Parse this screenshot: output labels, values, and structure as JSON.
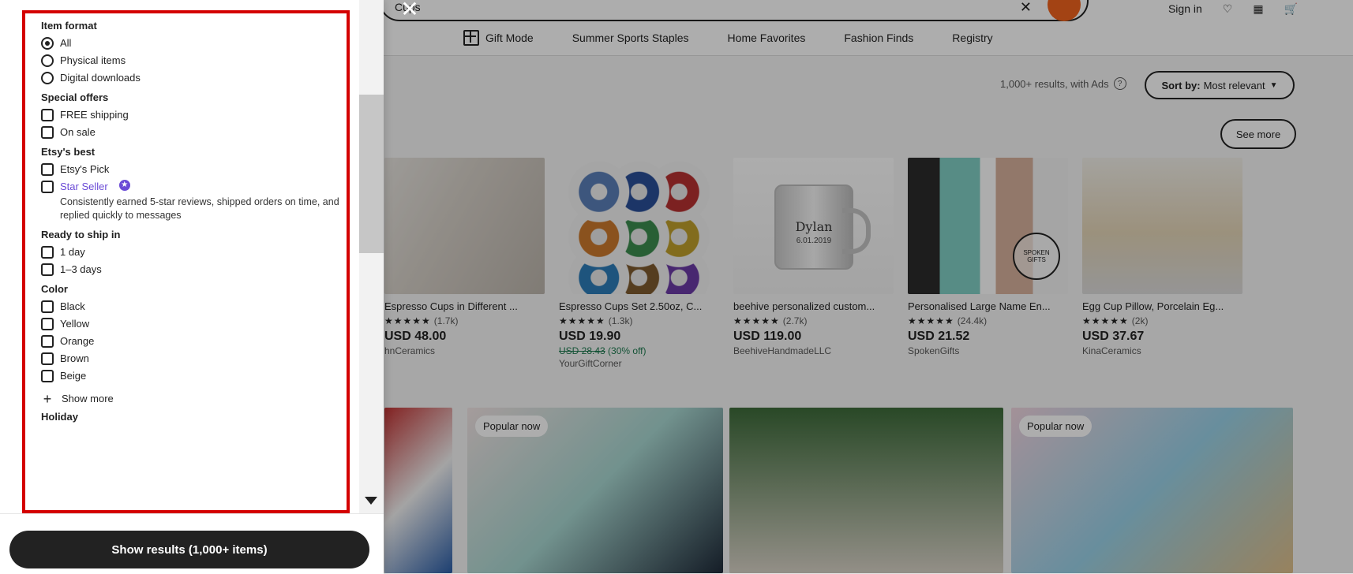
{
  "topbar": {
    "search_query": "Cups",
    "sign_in": "Sign in"
  },
  "nav": {
    "items": [
      {
        "label": "Gift Mode",
        "icon": "gift-icon"
      },
      {
        "label": "Summer Sports Staples"
      },
      {
        "label": "Home Favorites"
      },
      {
        "label": "Fashion Finds"
      },
      {
        "label": "Registry"
      }
    ]
  },
  "results": {
    "meta": "1,000+ results, with Ads",
    "sort_prefix": "Sort by:",
    "sort_value": "Most relevant",
    "see_more": "See more"
  },
  "cards": [
    {
      "title": "Espresso Cups in Different ...",
      "reviews": "(1.7k)",
      "price": "USD 48.00",
      "shop": "hnCeramics"
    },
    {
      "title": "Espresso Cups Set 2.50oz, C...",
      "reviews": "(1.3k)",
      "price": "USD 19.90",
      "old_price": "USD 28.43",
      "discount": "(30% off)",
      "shop": "YourGiftCorner"
    },
    {
      "title": "beehive personalized custom...",
      "reviews": "(2.7k)",
      "price": "USD 119.00",
      "shop": "BeehiveHandmadeLLC",
      "mug_name": "Dylan",
      "mug_date": "6.01.2019"
    },
    {
      "title": "Personalised Large Name En...",
      "reviews": "(24.4k)",
      "price": "USD 21.52",
      "shop": "SpokenGifts",
      "seal_top": "SPOKEN",
      "seal_bottom": "GIFTS"
    },
    {
      "title": "Egg Cup Pillow, Porcelain Eg...",
      "reviews": "(2k)",
      "price": "USD 37.67",
      "shop": "KinaCeramics"
    }
  ],
  "big_cards": [
    {
      "badge": ""
    },
    {
      "badge": "Popular now"
    },
    {
      "badge": ""
    },
    {
      "badge": "Popular now"
    }
  ],
  "filters": {
    "item_format": {
      "title": "Item format",
      "options": [
        "All",
        "Physical items",
        "Digital downloads"
      ]
    },
    "special_offers": {
      "title": "Special offers",
      "options": [
        "FREE shipping",
        "On sale"
      ]
    },
    "etsys_best": {
      "title": "Etsy's best",
      "options": [
        "Etsy's Pick",
        "Star Seller"
      ],
      "star_seller_desc": "Consistently earned 5-star reviews, shipped orders on time, and replied quickly to messages"
    },
    "ready_to_ship": {
      "title": "Ready to ship in",
      "options": [
        "1 day",
        "1–3 days"
      ]
    },
    "color": {
      "title": "Color",
      "options": [
        "Black",
        "Yellow",
        "Orange",
        "Brown",
        "Beige"
      ],
      "show_more": "Show more"
    },
    "holiday": {
      "title": "Holiday"
    }
  },
  "bottom": {
    "show_results": "Show results (1,000+ items)"
  },
  "colors": {
    "highlight_red": "#d40000",
    "accent_purple": "#6b4bd6",
    "search_orange": "#f1641e"
  }
}
